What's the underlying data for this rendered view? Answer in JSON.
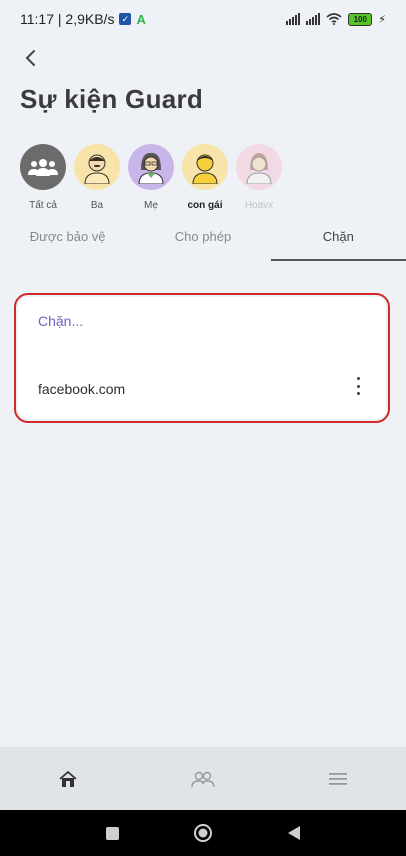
{
  "status_bar": {
    "time_speed": "11:17 | 2,9KB/s",
    "battery": "100"
  },
  "header": {
    "title": "Sự kiện Guard"
  },
  "profiles": [
    {
      "label": "Tất cả",
      "icon": "group-icon"
    },
    {
      "label": "Ba",
      "icon": "person-icon"
    },
    {
      "label": "Mẹ",
      "icon": "person-icon"
    },
    {
      "label": "con gái",
      "icon": "person-icon"
    },
    {
      "label": "Hoavx",
      "icon": "person-icon"
    }
  ],
  "tabs": [
    {
      "label": "Được bảo vệ",
      "active": false
    },
    {
      "label": "Cho phép",
      "active": false
    },
    {
      "label": "Chặn",
      "active": true
    }
  ],
  "blocked_card": {
    "heading": "Chặn...",
    "items": [
      {
        "domain": "facebook.com"
      }
    ]
  },
  "bottom_nav": [
    "home-icon",
    "people-icon",
    "menu-icon"
  ],
  "colors": {
    "accent_text": "#6d62c4",
    "highlight_border": "#cf2a2a",
    "background": "#eef1f6"
  }
}
